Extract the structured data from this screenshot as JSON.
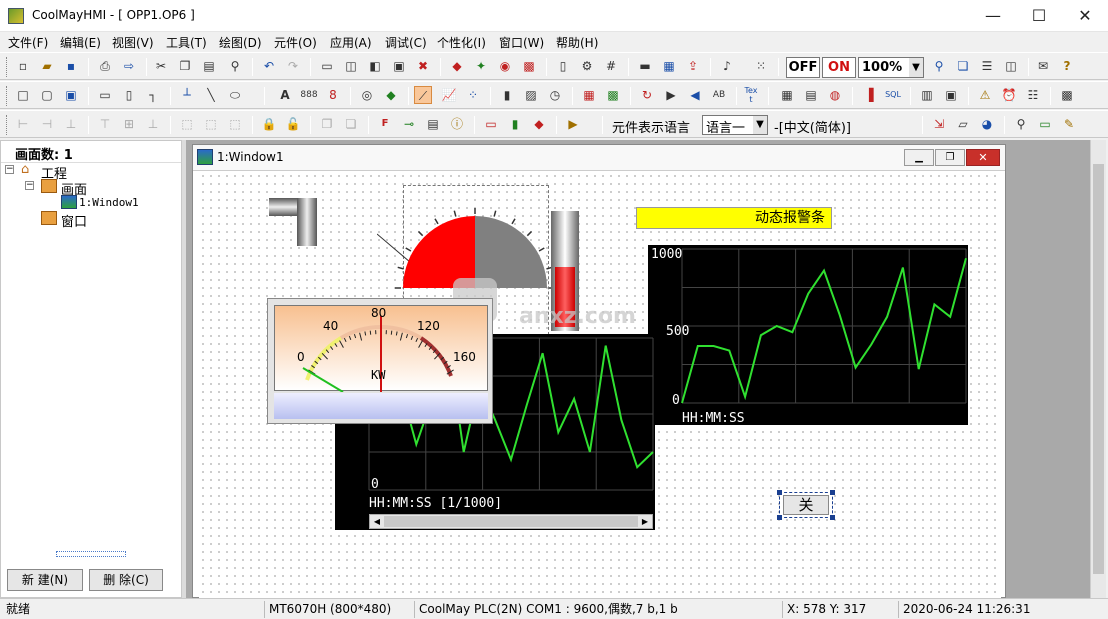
{
  "window": {
    "title": "CoolMayHMI - [ OPP1.OP6 ]",
    "minimize": "—",
    "maximize": "☐",
    "close": "✕"
  },
  "menu": [
    "文件(F)",
    "编辑(E)",
    "视图(V)",
    "工具(T)",
    "绘图(D)",
    "元件(O)",
    "应用(A)",
    "调试(C)",
    "个性化(I)",
    "窗口(W)",
    "帮助(H)"
  ],
  "toolbar": {
    "off_label": "OFF",
    "on_label": "ON",
    "zoom_value": "100%",
    "lang_label": "元件表示语言",
    "lang_select": "语言一",
    "lang_current": "-[中文(简体)]"
  },
  "left_panel": {
    "screen_count_label": "画面数: 1",
    "tree": {
      "root": "工程",
      "screens": "画面",
      "window1": "1:Window1",
      "windows": "窗口"
    },
    "new_button": "新 建(N)",
    "delete_button": "删 除(C)"
  },
  "document": {
    "title": "1:Window1"
  },
  "canvas": {
    "alarm_bar_text": "动态报警条",
    "meter_labels": [
      "0",
      "40",
      "80",
      "120",
      "160"
    ],
    "meter_unit": "KW",
    "trend1": {
      "y_labels": [
        "1000",
        "500",
        "0"
      ],
      "time_label": "HH:MM:SS",
      "values": [
        0,
        370,
        370,
        340,
        40,
        440,
        500,
        460,
        710,
        860,
        570,
        230,
        380,
        560,
        880,
        220,
        640,
        560,
        940
      ]
    },
    "trend2": {
      "y_labels": [
        "0"
      ],
      "time_label": "HH:MM:SS [1/1000]",
      "values": [
        720,
        550,
        680,
        300,
        600,
        980,
        250,
        700,
        460,
        200,
        560,
        900,
        380,
        600,
        250,
        950,
        460,
        150,
        250
      ]
    },
    "toggle_button_text": "关",
    "watermark": "anxz.com"
  },
  "status": {
    "ready": "就绪",
    "model": "MT6070H (800*480)",
    "plc": "CoolMay PLC(2N)  COM1 : 9600,偶数,7 b,1 b",
    "coords": "X: 578  Y: 317",
    "datetime": "2020-06-24  11:26:31"
  }
}
